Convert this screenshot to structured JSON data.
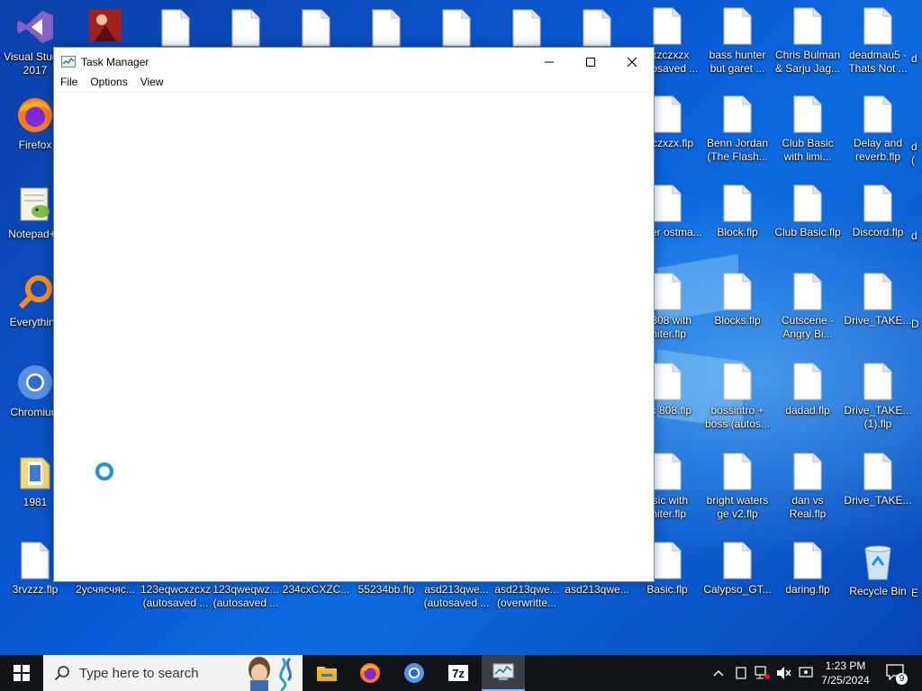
{
  "desktop": {
    "icons_col0": [
      {
        "label": "Visual Studio 2017",
        "kind": "vs"
      },
      {
        "label": "Firefox",
        "kind": "firefox"
      },
      {
        "label": "Notepad++",
        "kind": "notepad"
      },
      {
        "label": "Everything",
        "kind": "everything"
      },
      {
        "label": "Chromium",
        "kind": "chromium"
      },
      {
        "label": "1981",
        "kind": "folder"
      },
      {
        "label": "3rvzzz.flp",
        "kind": "file"
      }
    ],
    "bottom_row": [
      {
        "label": "2усчясчяс...",
        "kind": "file"
      },
      {
        "label": "123eqwcxzcxz (autosaved ...",
        "kind": "file"
      },
      {
        "label": "123qweqwz... (autosaved ...",
        "kind": "file"
      },
      {
        "label": "234cxCXZC...",
        "kind": "file"
      },
      {
        "label": "55234bb.flp",
        "kind": "file"
      },
      {
        "label": "asd213qwe... (autosaved ...",
        "kind": "file"
      },
      {
        "label": "asd213qwe... (overwritte...",
        "kind": "file"
      },
      {
        "label": "asd213qwe...",
        "kind": "file"
      }
    ],
    "col_partial": [
      {
        "label": "dxzczxzx autosaved ..."
      },
      {
        "label": "xzczxzx.flp"
      },
      {
        "label": "Asher ostma..."
      },
      {
        "label": "c 808 with miter.flp"
      },
      {
        "label": "sic 808.flp"
      },
      {
        "label": "asic with miter.flp"
      },
      {
        "label": "Basic.flp"
      }
    ],
    "col_bass": [
      {
        "label": "bass hunter but garet ..."
      },
      {
        "label": "Benn Jordan (The Flash..."
      },
      {
        "label": "Block.flp"
      },
      {
        "label": "Blocks.flp"
      },
      {
        "label": "bossintro + boss (autos..."
      },
      {
        "label": "bright waters ge v2.flp"
      },
      {
        "label": "Calypso_GT..."
      }
    ],
    "col_chris": [
      {
        "label": "Chris Bulman & Sarju Jag..."
      },
      {
        "label": "Club Basic with limi..."
      },
      {
        "label": "Club Basic.flp"
      },
      {
        "label": "Cutscene - Angry Bi..."
      },
      {
        "label": "dadad.flp"
      },
      {
        "label": "dan vs Real.flp"
      },
      {
        "label": "daring.flp"
      }
    ],
    "col_dead": [
      {
        "label": "deadmau5 - Thats Not ..."
      },
      {
        "label": "Delay and reverb.flp"
      },
      {
        "label": "Discord.flp"
      },
      {
        "label": "Drive_TAKE..."
      },
      {
        "label": "Drive_TAKE... (1).flp"
      },
      {
        "label": "Drive_TAKE..."
      },
      {
        "label": "Recycle Bin",
        "kind": "recycle"
      }
    ],
    "col_edge": [
      "d",
      "d (",
      "d",
      "D",
      "",
      "",
      "E"
    ]
  },
  "window": {
    "title": "Task Manager",
    "menu": [
      "File",
      "Options",
      "View"
    ],
    "controls": {
      "minimize": "minimize-icon",
      "maximize": "maximize-icon",
      "close": "close-icon"
    }
  },
  "taskbar": {
    "search_placeholder": "Type here to search",
    "time": "1:23 PM",
    "date": "7/25/2024",
    "notification_count": "9",
    "pinned": [
      "file-explorer-icon",
      "firefox-icon",
      "chromium-icon",
      "7zip-icon",
      "task-manager-icon"
    ],
    "seven_zip_label": "7z"
  }
}
